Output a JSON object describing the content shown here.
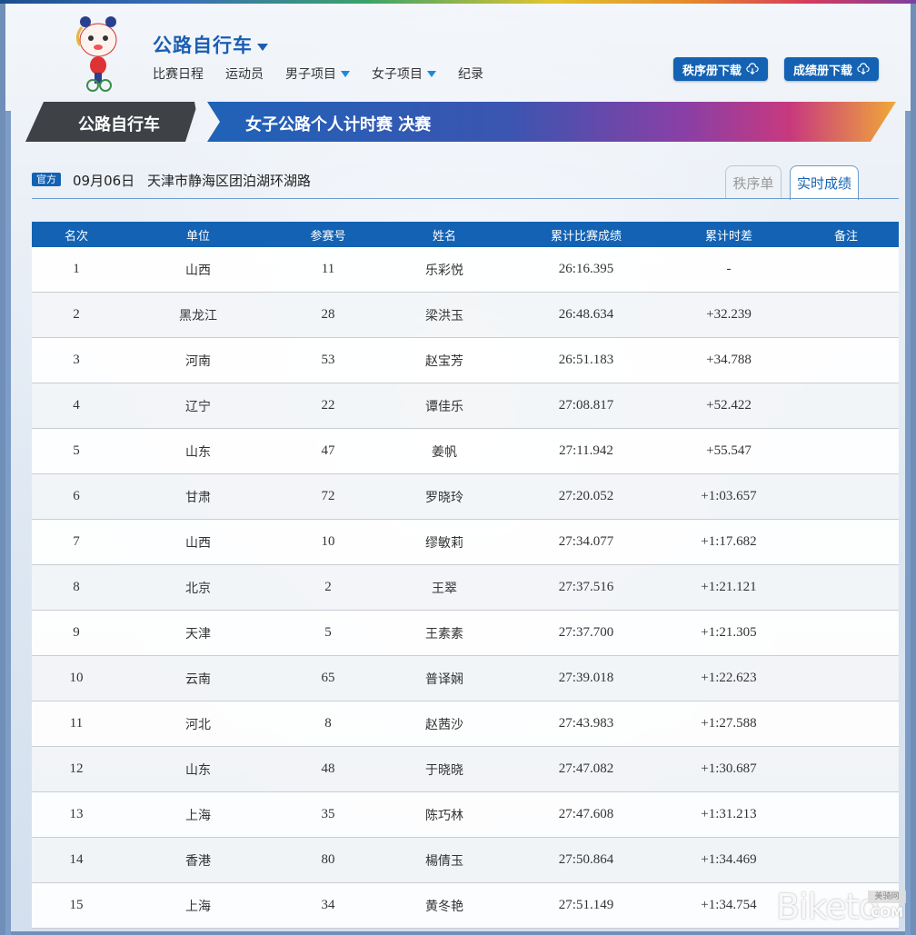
{
  "header": {
    "sport_title": "公路自行车",
    "nav": [
      {
        "label": "比赛日程",
        "has_dropdown": false
      },
      {
        "label": "运动员",
        "has_dropdown": false
      },
      {
        "label": "男子项目",
        "has_dropdown": true
      },
      {
        "label": "女子项目",
        "has_dropdown": true
      },
      {
        "label": "纪录",
        "has_dropdown": false
      }
    ],
    "download_start_list": "秩序册下载",
    "download_results": "成绩册下载"
  },
  "banner": {
    "sport": "公路自行车",
    "event": "女子公路个人计时赛 决赛"
  },
  "info": {
    "badge": "官方",
    "date": "09月06日",
    "venue": "天津市静海区团泊湖环湖路",
    "tab_start_list": "秩序单",
    "tab_live_results": "实时成绩",
    "active_tab": "实时成绩"
  },
  "table": {
    "headers": [
      "名次",
      "单位",
      "参赛号",
      "姓名",
      "累计比赛成绩",
      "累计时差",
      "备注"
    ],
    "rows": [
      {
        "rank": "1",
        "unit": "山西",
        "bib": "11",
        "name": "乐彩悦",
        "time": "26:16.395",
        "gap": "-",
        "note": ""
      },
      {
        "rank": "2",
        "unit": "黑龙江",
        "bib": "28",
        "name": "梁洪玉",
        "time": "26:48.634",
        "gap": "+32.239",
        "note": ""
      },
      {
        "rank": "3",
        "unit": "河南",
        "bib": "53",
        "name": "赵宝芳",
        "time": "26:51.183",
        "gap": "+34.788",
        "note": ""
      },
      {
        "rank": "4",
        "unit": "辽宁",
        "bib": "22",
        "name": "谭佳乐",
        "time": "27:08.817",
        "gap": "+52.422",
        "note": ""
      },
      {
        "rank": "5",
        "unit": "山东",
        "bib": "47",
        "name": "姜帆",
        "time": "27:11.942",
        "gap": "+55.547",
        "note": ""
      },
      {
        "rank": "6",
        "unit": "甘肃",
        "bib": "72",
        "name": "罗晓玲",
        "time": "27:20.052",
        "gap": "+1:03.657",
        "note": ""
      },
      {
        "rank": "7",
        "unit": "山西",
        "bib": "10",
        "name": "缪敏莉",
        "time": "27:34.077",
        "gap": "+1:17.682",
        "note": ""
      },
      {
        "rank": "8",
        "unit": "北京",
        "bib": "2",
        "name": "王翠",
        "time": "27:37.516",
        "gap": "+1:21.121",
        "note": ""
      },
      {
        "rank": "9",
        "unit": "天津",
        "bib": "5",
        "name": "王素素",
        "time": "27:37.700",
        "gap": "+1:21.305",
        "note": ""
      },
      {
        "rank": "10",
        "unit": "云南",
        "bib": "65",
        "name": "普译娴",
        "time": "27:39.018",
        "gap": "+1:22.623",
        "note": ""
      },
      {
        "rank": "11",
        "unit": "河北",
        "bib": "8",
        "name": "赵茜沙",
        "time": "27:43.983",
        "gap": "+1:27.588",
        "note": ""
      },
      {
        "rank": "12",
        "unit": "山东",
        "bib": "48",
        "name": "于晓晓",
        "time": "27:47.082",
        "gap": "+1:30.687",
        "note": ""
      },
      {
        "rank": "13",
        "unit": "上海",
        "bib": "35",
        "name": "陈巧林",
        "time": "27:47.608",
        "gap": "+1:31.213",
        "note": ""
      },
      {
        "rank": "14",
        "unit": "香港",
        "bib": "80",
        "name": "楊倩玉",
        "time": "27:50.864",
        "gap": "+1:34.469",
        "note": ""
      },
      {
        "rank": "15",
        "unit": "上海",
        "bib": "34",
        "name": "黄冬艳",
        "time": "27:51.149",
        "gap": "+1:34.754",
        "note": ""
      }
    ]
  },
  "watermark": {
    "brand": "Biketo",
    "cn": "美骑网",
    "com": "COM"
  },
  "colors": {
    "primary_blue": "#1362b3",
    "nav_caret": "#1e88d6",
    "title_blue": "#1b5db3"
  }
}
